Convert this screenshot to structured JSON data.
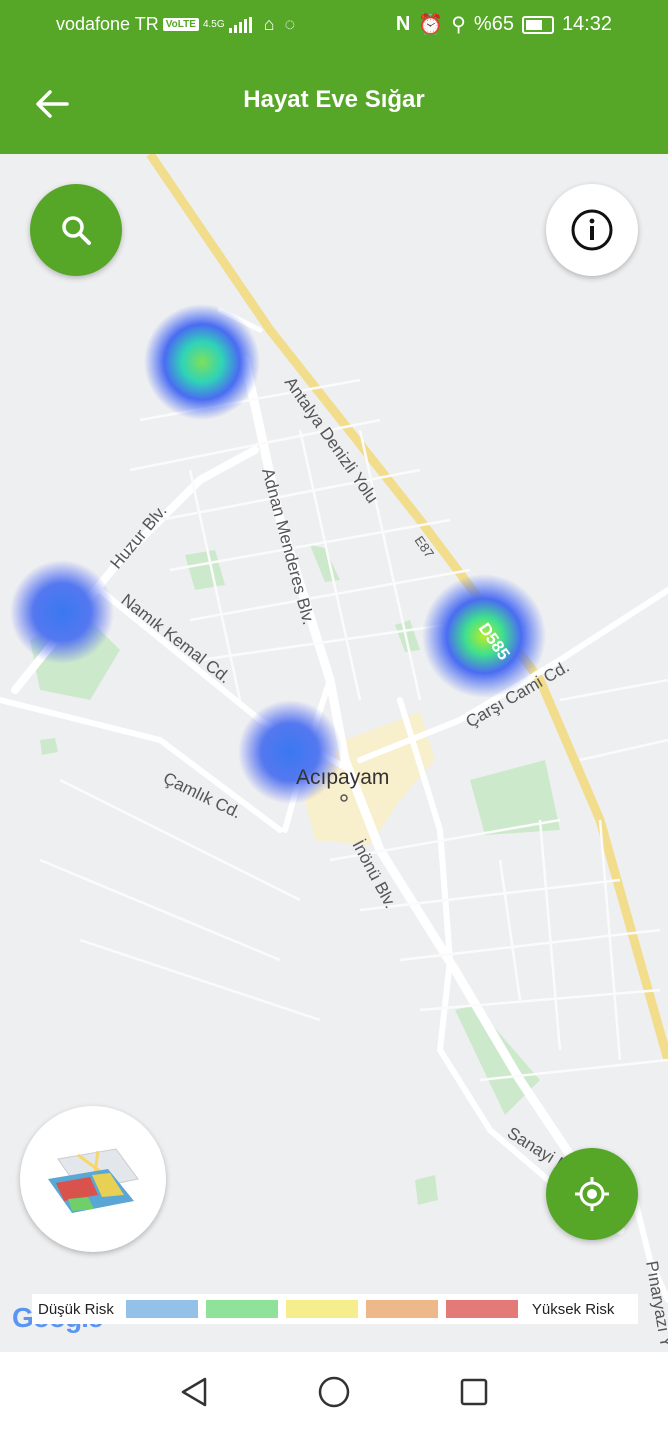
{
  "status_bar": {
    "carrier": "vodafone TR",
    "volte": "VoLTE",
    "network": "4.5G",
    "battery": "%65",
    "time": "14:32"
  },
  "app_bar": {
    "title": "Hayat Eve Sığar",
    "back_icon": "arrow-left-icon"
  },
  "map": {
    "town_label": "Acıpayam",
    "streets": [
      "Antalya Denizli Yolu",
      "E87",
      "D585",
      "Adnan Menderes Blv.",
      "Huzur Blv.",
      "Namık Kemal Cd.",
      "Çarşı Cami Cd.",
      "Çamlık Cd.",
      "İnönü Blv.",
      "Sanayi Blv.",
      "Pınaryazı Y"
    ],
    "attribution": "Google"
  },
  "buttons": {
    "search_icon": "search-icon",
    "info_icon": "info-icon",
    "layers_icon": "map-layers-icon",
    "locate_icon": "my-location-icon"
  },
  "legend": {
    "low_label": "Düşük Risk",
    "high_label": "Yüksek Risk",
    "colors": [
      "#94c1e8",
      "#8fe29a",
      "#f6ee8d",
      "#eeb98a",
      "#e37a78"
    ]
  },
  "nav": {
    "back": "triangle-back-icon",
    "home": "circle-home-icon",
    "recents": "square-recents-icon"
  }
}
